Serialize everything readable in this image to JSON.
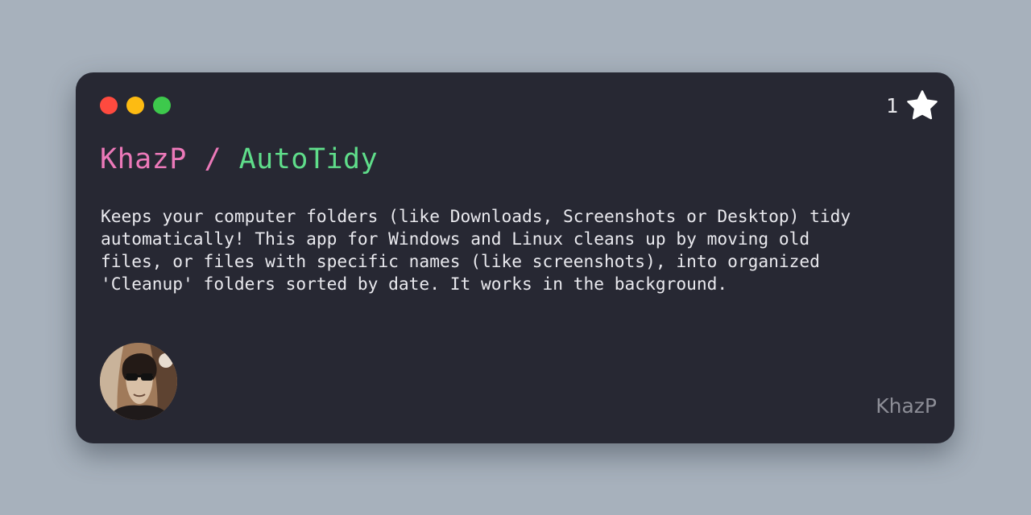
{
  "window": {
    "controls": [
      {
        "name": "close",
        "color": "#fe4a3f"
      },
      {
        "name": "minimize",
        "color": "#fdbb12"
      },
      {
        "name": "maximize",
        "color": "#3dc94c"
      }
    ]
  },
  "repo": {
    "owner": "KhazP",
    "separator": "/",
    "name": "AutoTidy",
    "stars": "1",
    "star_icon": "star-icon",
    "description_lines": [
      "Keeps your computer folders (like Downloads, Screenshots or Desktop) tidy",
      "automatically! This app for Windows and Linux cleans up by moving old",
      "files, or files with specific names (like screenshots), into organized",
      "'Cleanup' folders sorted by date. It works in the background."
    ]
  },
  "author": {
    "username": "KhazP",
    "avatar_icon": "avatar-image"
  },
  "colors": {
    "background": "#a7b1bc",
    "card": "#272833",
    "owner": "#ec79b9",
    "repo_name": "#5fdd8a",
    "text": "#e9e9ee",
    "muted": "#8d8e97"
  }
}
